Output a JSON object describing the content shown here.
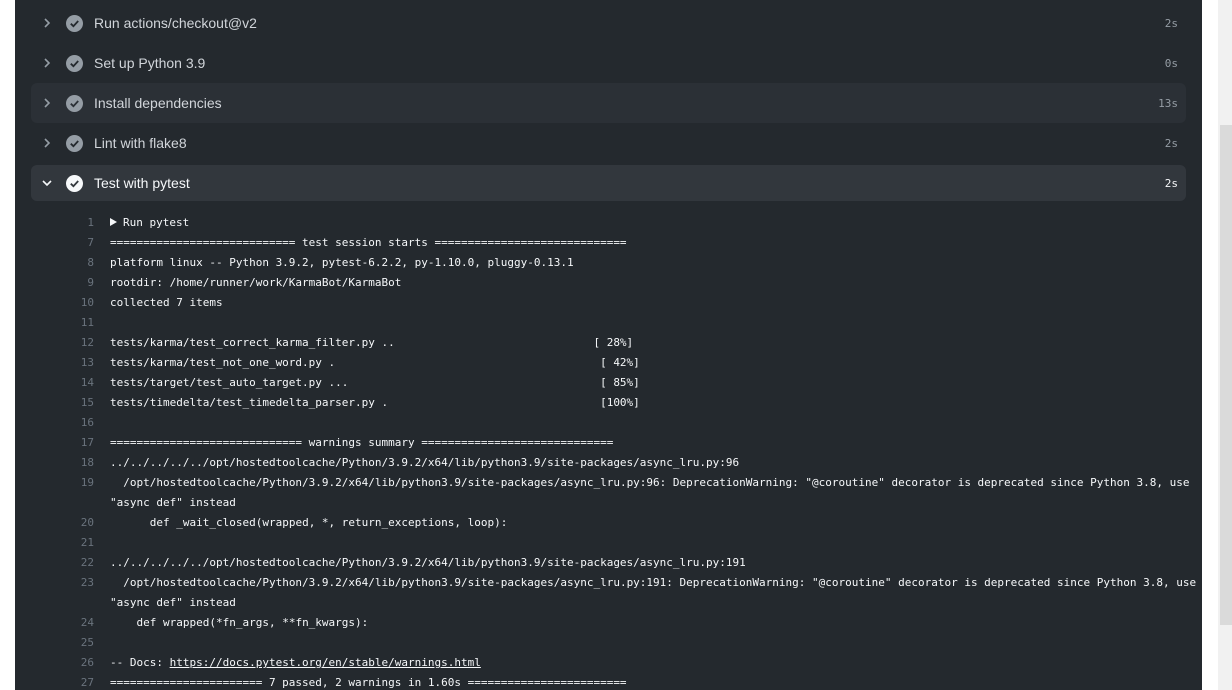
{
  "steps": [
    {
      "label": "Run actions/checkout@v2",
      "time": "2s"
    },
    {
      "label": "Set up Python 3.9",
      "time": "0s"
    },
    {
      "label": "Install dependencies",
      "time": "13s"
    },
    {
      "label": "Lint with flake8",
      "time": "2s"
    },
    {
      "label": "Test with pytest",
      "time": "2s"
    }
  ],
  "log": {
    "run_line": {
      "num": "1",
      "text": "Run pytest"
    },
    "lines": [
      {
        "num": "7",
        "text": "============================ test session starts ============================="
      },
      {
        "num": "8",
        "text": "platform linux -- Python 3.9.2, pytest-6.2.2, py-1.10.0, pluggy-0.13.1"
      },
      {
        "num": "9",
        "text": "rootdir: /home/runner/work/KarmaBot/KarmaBot"
      },
      {
        "num": "10",
        "text": "collected 7 items"
      },
      {
        "num": "11",
        "text": ""
      },
      {
        "num": "12",
        "text": "tests/karma/test_correct_karma_filter.py ..                              [ 28%]"
      },
      {
        "num": "13",
        "text": "tests/karma/test_not_one_word.py .                                        [ 42%]"
      },
      {
        "num": "14",
        "text": "tests/target/test_auto_target.py ...                                      [ 85%]"
      },
      {
        "num": "15",
        "text": "tests/timedelta/test_timedelta_parser.py .                                [100%]"
      },
      {
        "num": "16",
        "text": ""
      },
      {
        "num": "17",
        "text": "============================= warnings summary ============================="
      },
      {
        "num": "18",
        "text": "../../../../../opt/hostedtoolcache/Python/3.9.2/x64/lib/python3.9/site-packages/async_lru.py:96"
      },
      {
        "num": "19",
        "text": "  /opt/hostedtoolcache/Python/3.9.2/x64/lib/python3.9/site-packages/async_lru.py:96: DeprecationWarning: \"@coroutine\" decorator is deprecated since Python 3.8, use \"async def\" instead"
      },
      {
        "num": "20",
        "text": "      def _wait_closed(wrapped, *, return_exceptions, loop):"
      },
      {
        "num": "21",
        "text": ""
      },
      {
        "num": "22",
        "text": "../../../../../opt/hostedtoolcache/Python/3.9.2/x64/lib/python3.9/site-packages/async_lru.py:191"
      },
      {
        "num": "23",
        "text": "  /opt/hostedtoolcache/Python/3.9.2/x64/lib/python3.9/site-packages/async_lru.py:191: DeprecationWarning: \"@coroutine\" decorator is deprecated since Python 3.8, use \"async def\" instead"
      },
      {
        "num": "24",
        "text": "    def wrapped(*fn_args, **fn_kwargs):"
      },
      {
        "num": "25",
        "text": ""
      }
    ],
    "docs_line": {
      "num": "26",
      "prefix": "-- Docs: ",
      "link": "https://docs.pytest.org/en/stable/warnings.html"
    },
    "summary_line": {
      "num": "27",
      "text": "======================= 7 passed, 2 warnings in 1.60s ========================"
    }
  },
  "colors": {
    "panel_bg": "#24292e",
    "expanded_bg": "#32373d",
    "text": "#f6f8fa",
    "muted": "#959da5"
  }
}
